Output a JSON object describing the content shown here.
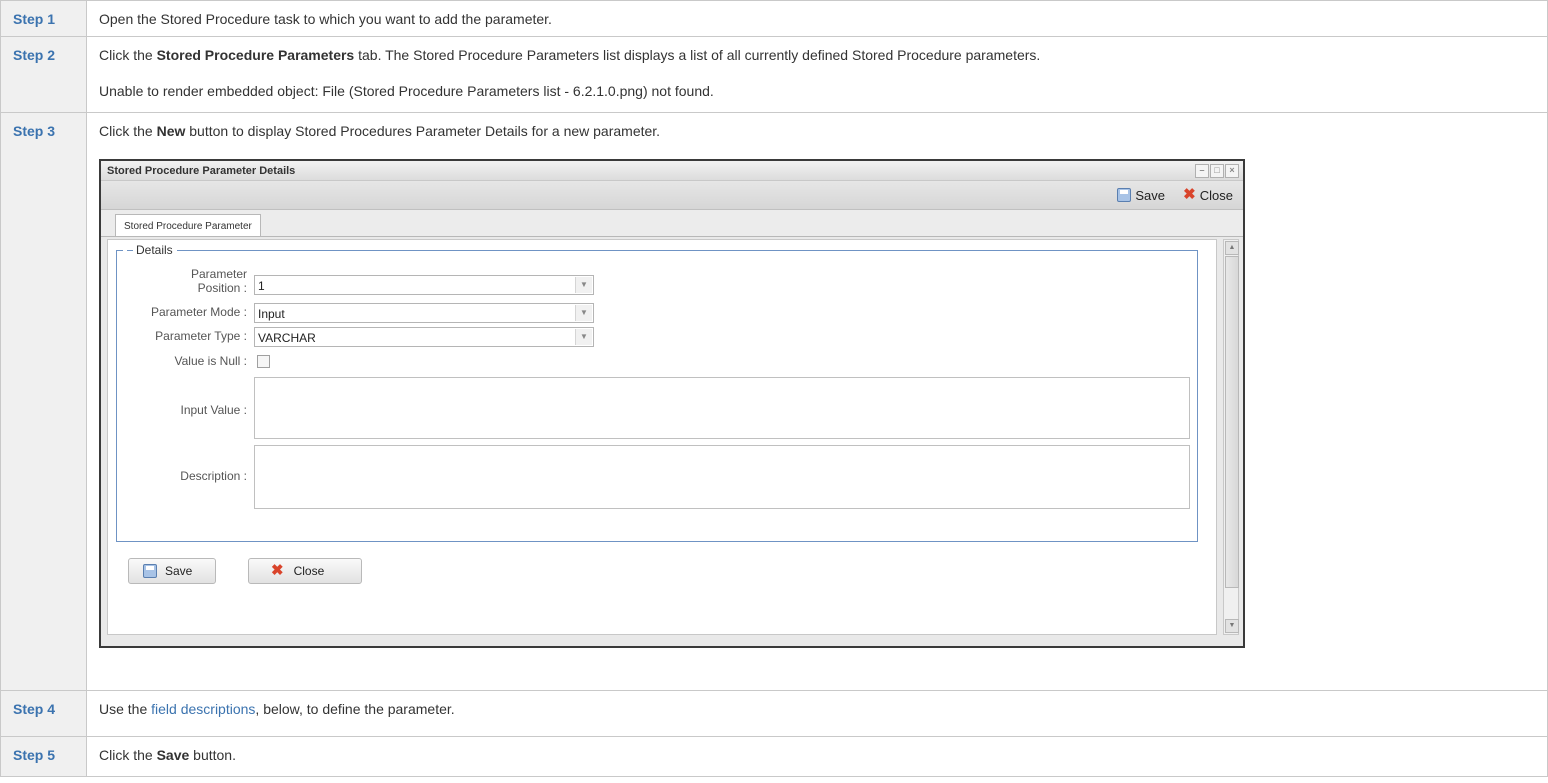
{
  "steps": [
    {
      "label": "Step 1",
      "text": "Open the Stored Procedure task to which you want to add the parameter."
    },
    {
      "label": "Step 2",
      "pre": "Click the ",
      "bold": "Stored Procedure Parameters",
      "post": " tab. The Stored Procedure Parameters list displays a list of all currently defined Stored Procedure parameters.",
      "note": "Unable to render embedded object: File (Stored Procedure Parameters list - 6.2.1.0.png) not found."
    },
    {
      "label": "Step 3",
      "pre": "Click the ",
      "bold": "New",
      "post": " button to display Stored Procedures Parameter Details for a new parameter."
    },
    {
      "label": "Step 4",
      "pre": "Use the ",
      "link": "field descriptions",
      "post": ", below, to define the parameter."
    },
    {
      "label": "Step 5",
      "pre": "Click the ",
      "bold": "Save",
      "post": " button."
    }
  ],
  "dialog": {
    "title": "Stored Procedure Parameter Details",
    "toolbar": {
      "save_label": "Save",
      "close_label": "Close"
    },
    "tab_label": "Stored Procedure Parameter",
    "section_label": "Details",
    "fields": {
      "position_label_1": "Parameter",
      "position_label_2": "Position :",
      "position_value": "1",
      "mode_label": "Parameter Mode :",
      "mode_value": "Input",
      "type_label": "Parameter Type :",
      "type_value": "VARCHAR",
      "null_label": "Value is Null :",
      "input_value_label": "Input Value :",
      "description_label": "Description :"
    },
    "bottom_buttons": {
      "save_label": "Save",
      "close_label": "Close"
    },
    "window_buttons": [
      "–",
      "□",
      "×"
    ]
  }
}
